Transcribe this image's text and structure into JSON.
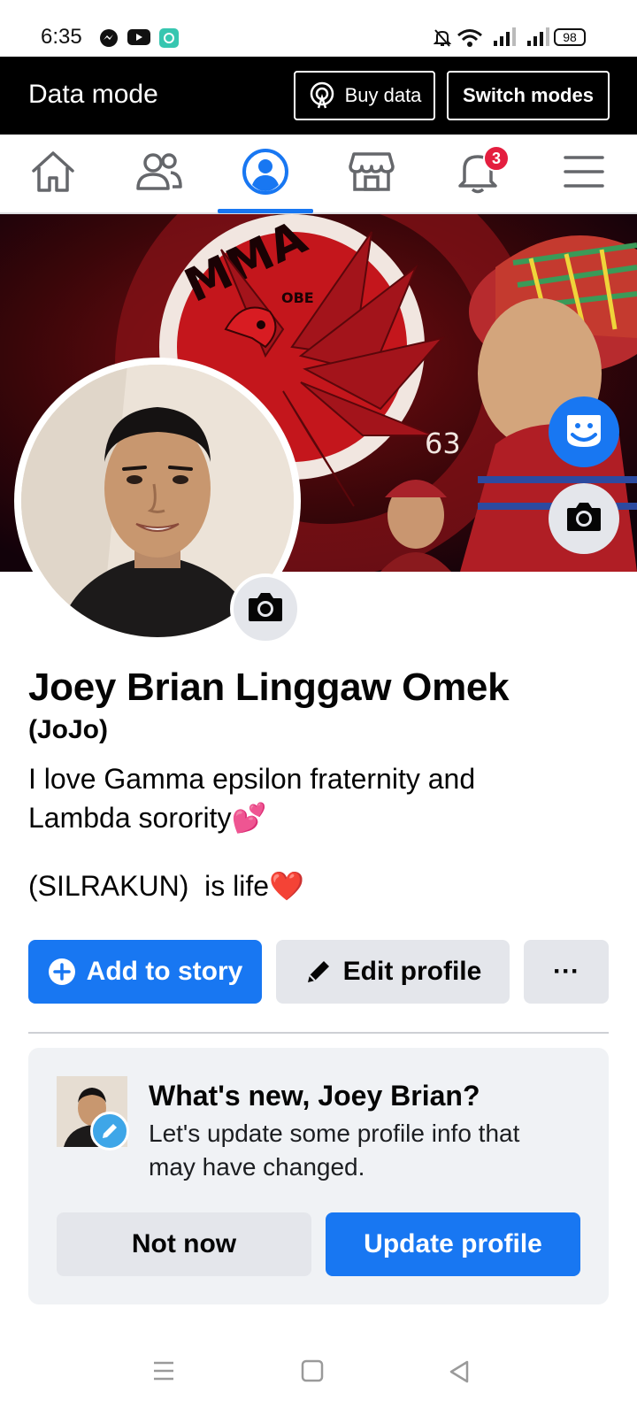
{
  "status_bar": {
    "time": "6:35",
    "battery": "98",
    "icons": [
      "messenger-icon",
      "youtube-icon",
      "app-icon",
      "mute-icon",
      "wifi-icon",
      "signal-icon"
    ]
  },
  "data_mode": {
    "title": "Data mode",
    "buy_label": "Buy data",
    "switch_label": "Switch modes"
  },
  "nav": {
    "items": [
      "home-icon",
      "friends-icon",
      "profile-icon",
      "marketplace-icon",
      "notifications-icon",
      "menu-icon"
    ],
    "notifications_badge": "3",
    "active_color": "#1877f2"
  },
  "cover": {
    "text_mma": "MMA",
    "text_obe": "OBE",
    "text_num": "63"
  },
  "profile": {
    "name": "Joey Brian Linggaw Omek",
    "nickname": "(JoJo)",
    "bio_line1": "I love Gamma epsilon fraternity and",
    "bio_line2": "Lambda sorority",
    "bio_emoji1": "💕",
    "bio_line3": "(SILRAKUN)  is life",
    "bio_emoji2": "❤️"
  },
  "actions": {
    "add_story": "Add to story",
    "edit_profile": "Edit profile",
    "more": "···"
  },
  "whats_new": {
    "title": "What's new, Joey Brian?",
    "subtitle": "Let's update some profile info that may have changed.",
    "not_now": "Not now",
    "update": "Update profile"
  },
  "colors": {
    "brand_blue": "#1877f2",
    "button_gray": "#e4e6eb",
    "card_bg": "#f0f2f5",
    "badge_red": "#e41e3f"
  }
}
